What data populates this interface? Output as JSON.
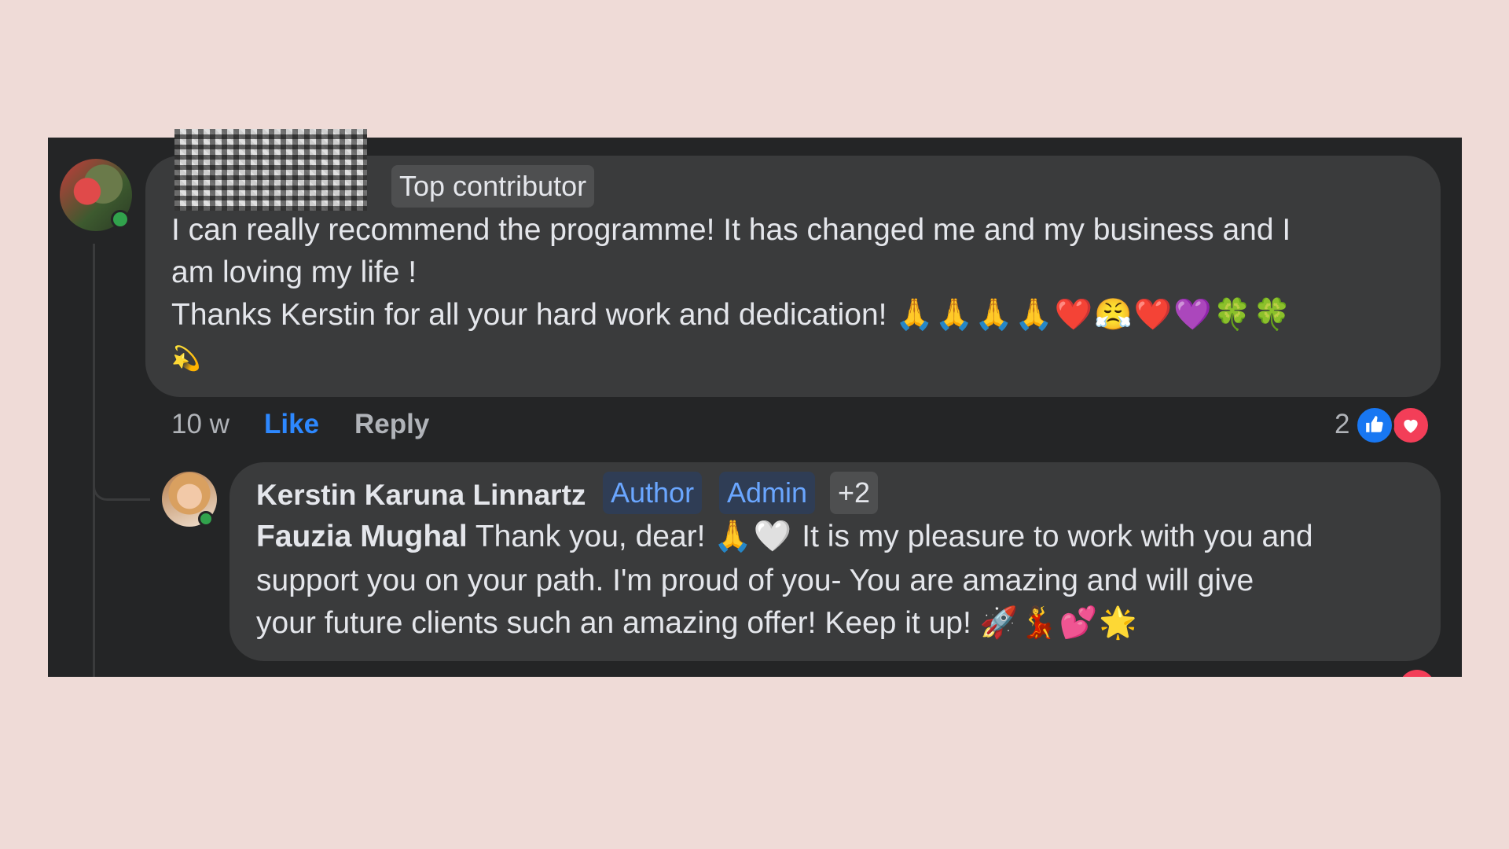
{
  "comment": {
    "badge": "Top contributor",
    "line1": "I can really recommend the programme! It has changed me and my business and I",
    "line2": "am loving my life !",
    "line3_text": "Thanks Kerstin for all your hard work and dedication! ",
    "line3_emojis": "🙏🙏🙏🙏❤️😤❤️💜🍀🍀",
    "line4_emojis": "💫",
    "time": "10 w",
    "like_label": "Like",
    "reply_label": "Reply",
    "reaction_count": "2",
    "reactions": [
      "like-icon",
      "love-icon"
    ]
  },
  "reply": {
    "author": "Kerstin Karuna Linnartz",
    "badges": [
      "Author",
      "Admin",
      "+2"
    ],
    "mention": "Fauzia Mughal",
    "line1_text": " Thank you, dear! ",
    "line1_emojis": "🙏🤍",
    "line1_rest": " It is my pleasure to work with you and",
    "line2": "support you on your path. I'm proud of you- You are amazing and will give",
    "line3_text": "your future clients such an amazing offer! Keep it up! ",
    "line3_emojis": "🚀💃💕🌟"
  },
  "colors": {
    "background": "#efdbd7",
    "panel": "#242526",
    "bubble": "#3a3b3c",
    "like_blue": "#2d88ff",
    "love_red": "#f33e58",
    "online_green": "#31a24c"
  }
}
